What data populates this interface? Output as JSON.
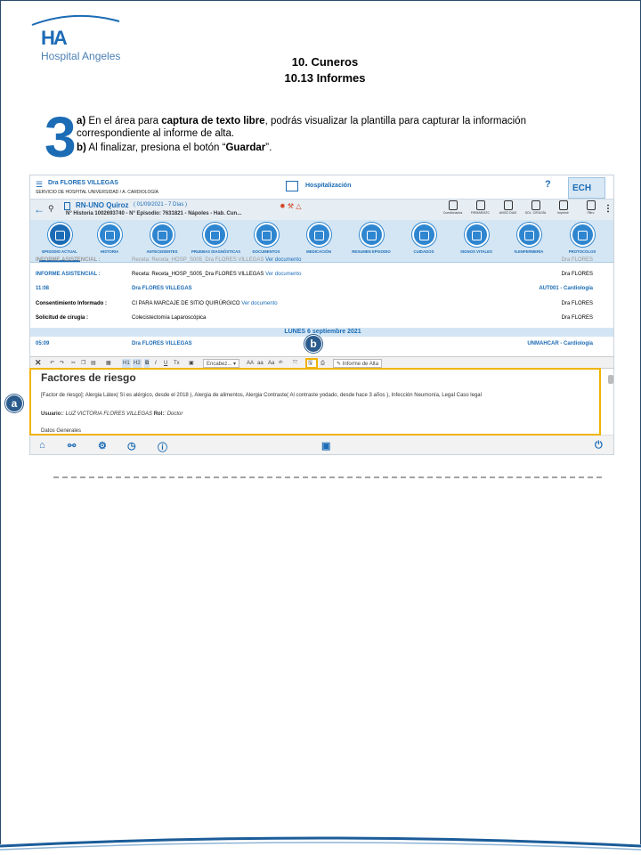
{
  "brand": {
    "logo_mark": "HA",
    "logo_text": "Hospital Angeles",
    "color": "#1b6bb5"
  },
  "title": {
    "line1": "10. Cuneros",
    "line2": "10.13 Informes"
  },
  "step": {
    "number": "3",
    "a_prefix": "a)",
    "a_text_1": " En el área para ",
    "a_bold": "captura de texto libre",
    "a_text_2": ", podrás visualizar la plantilla para capturar la información correspondiente al informe de alta.",
    "b_prefix": "b)",
    "b_text_1": " Al finalizar, presiona el botón “",
    "b_bold": "Guardar",
    "b_text_2": "”."
  },
  "app": {
    "doctor": "Dra FLORES VILLEGAS",
    "service": "SERVICIO DE HOSPITAL UNIVERSIDAD / A. CARDIOLOGÍA",
    "module": "Hospitalización",
    "help": "?",
    "ech": "ECH",
    "patient_name": "RN-UNO Quiroz",
    "patient_date": "( 01/09/2021 - 7 Días )",
    "patient_line2": "N° Historia 1002693740 - N° Episodio: 7631821   - Nápoles - Hab. Cun...",
    "tools": [
      "Cuestionarios",
      "FIRMAR/ATC",
      "AVISO DIAS",
      "SOL. CIRUGÍA",
      "Imprimir",
      "Filtro"
    ],
    "nav": [
      "EPISODIO ACTUAL",
      "HISTORIA",
      "ANTECEDENTES",
      "PRUEBAS DIAGNÓSTICAS",
      "DOCUMENTOS",
      "MEDICACIÓN",
      "RESUMEN EPISODIO",
      "CUIDADOS",
      "SIGNOS VITALES",
      "N.ENFERMERÍA",
      "PROTOCOLOS"
    ],
    "records": {
      "r0_c1": "INFORME ASISTENCIAL :",
      "r0_c2": "Receta: Receta_HOSP_S005_Dra FLORES VILLEGAS",
      "r0_c2_link": "Ver documento",
      "r0_c3": "Dra FLORES",
      "r1_c1": "INFORME ASISTENCIAL :",
      "r1_c2": "Receta: Receta_HOSP_S005_Dra FLORES VILLEGAS",
      "r1_c2_link": "Ver documento",
      "r1_c3": "Dra FLORES",
      "r2_c1": "11:08",
      "r2_c2": "Dra FLORES VILLEGAS",
      "r2_c3": "AUT001 -  Cardiología",
      "r3_c1": "Consentimiento Informado :",
      "r3_c2": "CI PARA MARCAJE DE SITIO QUIRÚRGICO",
      "r3_c2_link": "Ver documento",
      "r3_c3": "Dra FLORES",
      "r4_c1": "Solicitud de cirugía :",
      "r4_c2": "Colecistectomía Laparoscópica",
      "r4_c3": "Dra FLORES",
      "date_band": "LUNES 6 septiembre 2021",
      "r5_c1": "05:09",
      "r5_c2": "Dra FLORES VILLEGAS",
      "r5_c3": "UNMAHCAR -  Cardiología"
    },
    "toolbar": {
      "close": "✕",
      "h1": "H1",
      "h2": "H2",
      "bold": "B",
      "italic": "I",
      "underline": "U",
      "clear": "Tx",
      "heading": "Encabez...",
      "aa1": "AA",
      "aa2": "aa",
      "aa3": "Aa",
      "report": "Informe de Alta"
    },
    "editor": {
      "title": "Factores de riesgo",
      "risk": "[Factor de riesgo]: Alergia  Látex( Sí es alérgico, desde el 2018 ), Alergia de alimentos, Alergia Contraste( Al contraste yodado, desde hace 3 años ), Infección Neumonía, Legal Caso legal",
      "user_label": "Usuario:",
      "user_name": ": LUZ VICTORIA FLORES VILLEGAS",
      "role_label": "Rol:",
      "role_value": ": Doctor",
      "general": "Datos Generales"
    }
  },
  "badges": {
    "a": "a",
    "b": "b",
    "color": "#2b5b8c",
    "highlight": "#f0b400"
  }
}
